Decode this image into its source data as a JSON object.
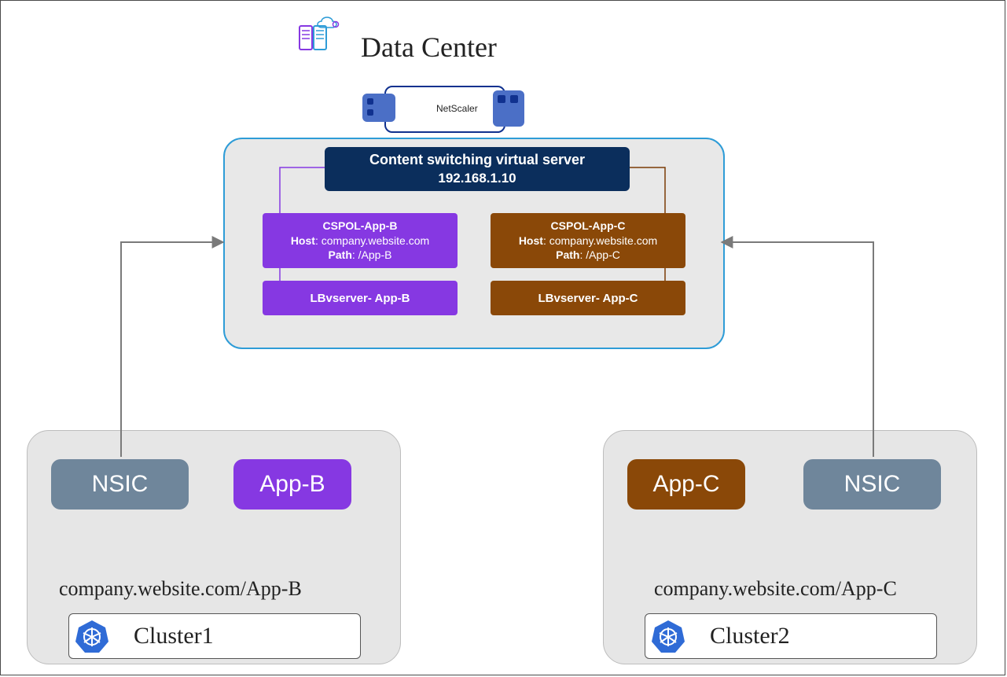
{
  "datacenter": {
    "title": "Data Center",
    "netscaler_label": "NetScaler",
    "cs_server": {
      "title": "Content switching virtual server",
      "ip": "192.168.1.10"
    },
    "policies": {
      "b": {
        "name": "CSPOL-App-B",
        "host_label": "Host",
        "host": "company.website.com",
        "path_label": "Path",
        "path": "/App-B"
      },
      "c": {
        "name": "CSPOL-App-C",
        "host_label": "Host",
        "host": "company.website.com",
        "path_label": "Path",
        "path": "/App-C"
      }
    },
    "lb": {
      "b": "LBvserver- App-B",
      "c": "LBvserver- App-C"
    }
  },
  "clusters": {
    "c1": {
      "nsic": "NSIC",
      "app": "App-B",
      "url": "company.website.com/App-B",
      "name": "Cluster1"
    },
    "c2": {
      "nsic": "NSIC",
      "app": "App-C",
      "url": "company.website.com/App-C",
      "name": "Cluster2"
    }
  }
}
